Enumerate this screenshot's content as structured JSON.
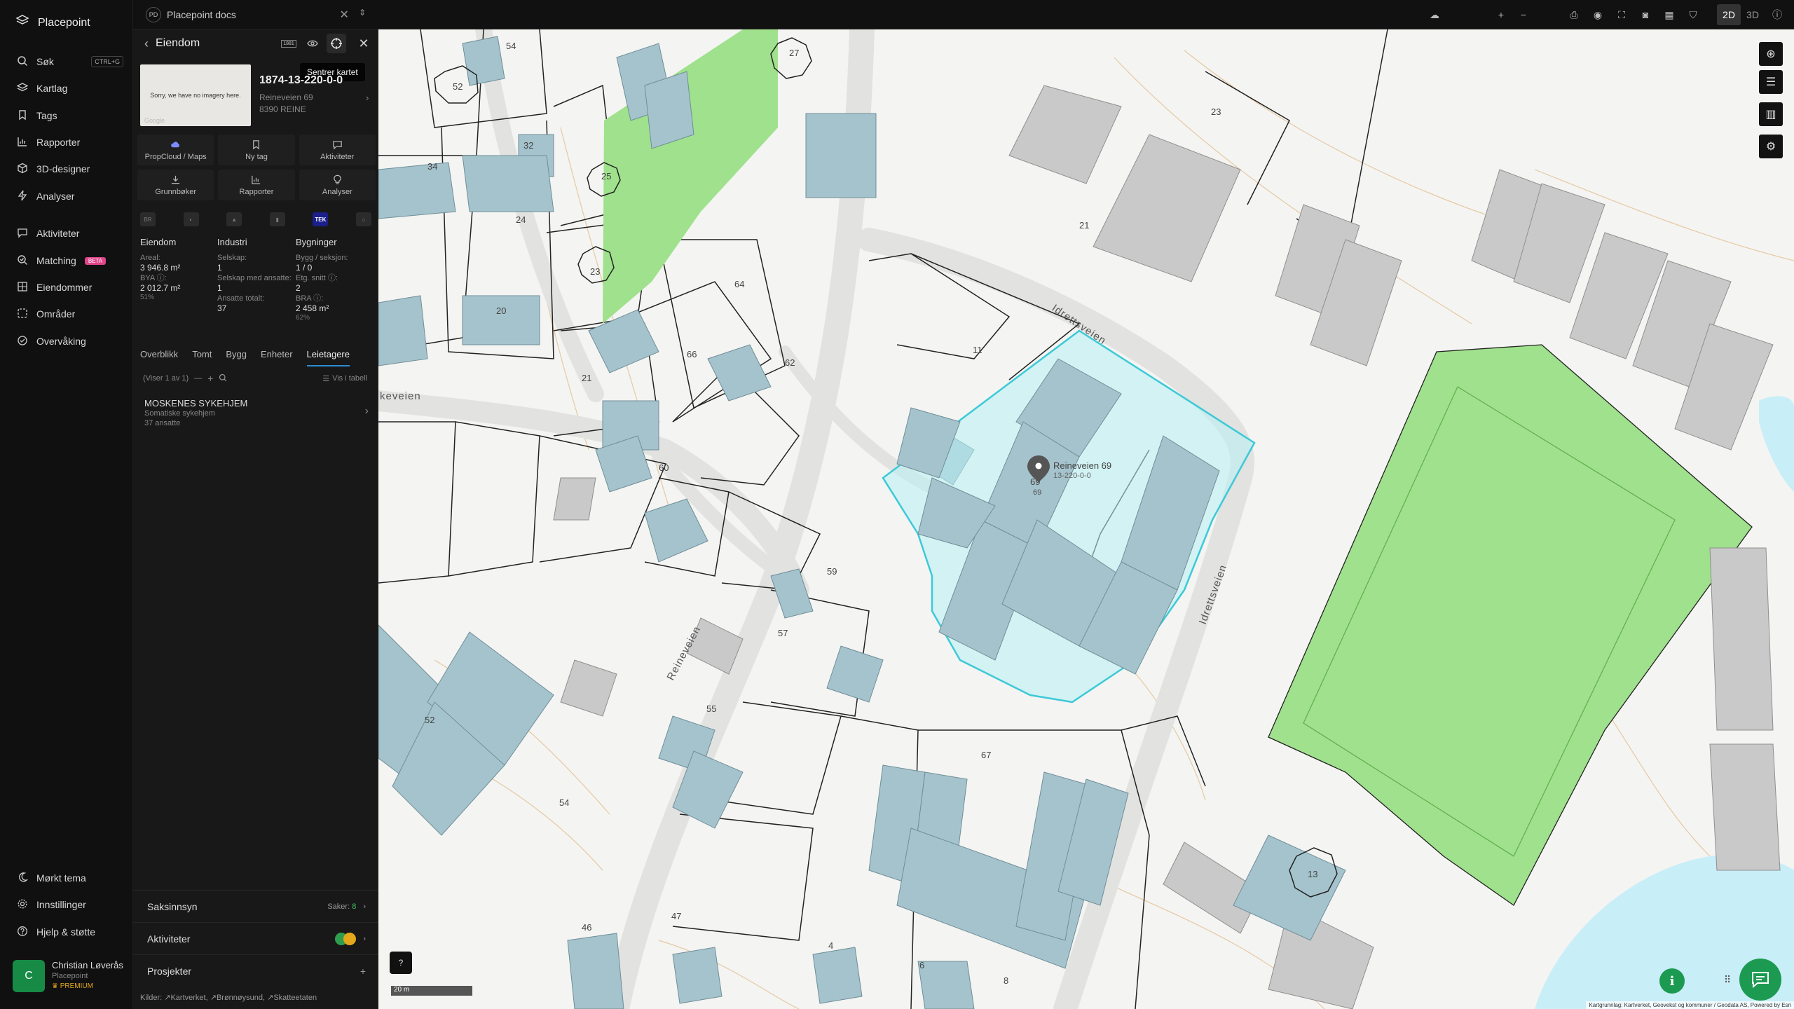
{
  "app": {
    "name": "Placepoint"
  },
  "sidebar": {
    "items": [
      {
        "label": "Søk",
        "shortcut": "CTRL+G"
      },
      {
        "label": "Kartlag"
      },
      {
        "label": "Tags"
      },
      {
        "label": "Rapporter"
      },
      {
        "label": "3D-designer"
      },
      {
        "label": "Analyser"
      },
      {
        "label": "Aktiviteter"
      },
      {
        "label": "Matching",
        "badge": "BETA"
      },
      {
        "label": "Eiendommer"
      },
      {
        "label": "Områder"
      },
      {
        "label": "Overvåking"
      }
    ],
    "bottom": [
      {
        "label": "Mørkt tema"
      },
      {
        "label": "Innstillinger"
      },
      {
        "label": "Hjelp & støtte"
      }
    ],
    "user": {
      "initial": "C",
      "name": "Christian Løverås",
      "org": "Placepoint",
      "plan": "PREMIUM"
    }
  },
  "panel": {
    "workspace": {
      "badge": "PD",
      "title": "Placepoint docs"
    },
    "header": {
      "title": "Eiendom",
      "badge_1881": "1881",
      "tooltip": "Sentrer kartet"
    },
    "property": {
      "thumbnail_text": "Sorry, we have no imagery here.",
      "thumbnail_brand": "Google",
      "id": "1874-13-220-0-0",
      "address": "Reineveien 69",
      "postal": "8390 REINE"
    },
    "actions": [
      {
        "label": "PropCloud / Maps",
        "icon": "propcloud-icon"
      },
      {
        "label": "Ny tag",
        "icon": "bookmark-icon"
      },
      {
        "label": "Aktiviteter",
        "icon": "chat-icon"
      },
      {
        "label": "Grunnbøker",
        "icon": "download-icon"
      },
      {
        "label": "Rapporter",
        "icon": "chart-icon"
      },
      {
        "label": "Analyser",
        "icon": "bulb-icon"
      }
    ],
    "sources": [
      {
        "label": "BR"
      },
      {
        "label": "◐"
      },
      {
        "label": "▲"
      },
      {
        "label": "▮"
      },
      {
        "label": "TEK"
      },
      {
        "label": "⌂"
      }
    ],
    "stats": {
      "eiendom": {
        "title": "Eiendom",
        "areal_label": "Areal:",
        "areal": "3 946.8 m²",
        "bya_label": "BYA ⓘ:",
        "bya": "2 012.7 m²",
        "bya_pct": "51%"
      },
      "industri": {
        "title": "Industri",
        "selskap_label": "Selskap:",
        "selskap": "1",
        "ansatte_label": "Selskap med ansatte:",
        "ansatte": "1",
        "total_label": "Ansatte totalt:",
        "total": "37"
      },
      "bygninger": {
        "title": "Bygninger",
        "bygg_label": "Bygg / seksjon:",
        "bygg": "1 / 0",
        "etg_label": "Etg. snitt ⓘ:",
        "etg": "2",
        "bra_label": "BRA ⓘ:",
        "bra": "2 458 m²",
        "bra_pct": "62%"
      }
    },
    "tabs": [
      {
        "label": "Overblikk"
      },
      {
        "label": "Tomt"
      },
      {
        "label": "Bygg"
      },
      {
        "label": "Enheter"
      },
      {
        "label": "Leietagere",
        "active": true
      }
    ],
    "list": {
      "count": "(Viser 1 av 1)",
      "table_label": "Vis i tabell"
    },
    "tenant": {
      "name": "MOSKENES SYKEHJEM",
      "type": "Somatiske sykehjem",
      "employees": "37 ansatte"
    },
    "sections": {
      "saksinnsyn": {
        "label": "Saksinnsyn",
        "count_label": "Saker:",
        "count": "8"
      },
      "aktiviteter": {
        "label": "Aktiviteter"
      },
      "prosjekter": {
        "label": "Prosjekter"
      }
    },
    "footer": {
      "label": "Kilder:",
      "s1": "Kartverket,",
      "s2": "Brønnøysund,",
      "s3": "Skatteetaten"
    }
  },
  "topbar": {
    "north": "N",
    "mode_2d": "2D",
    "mode_3d": "3D"
  },
  "map": {
    "roads": [
      {
        "label": "Idrettsveien"
      },
      {
        "label": "Idrettsveien"
      },
      {
        "label": "Reineveien"
      },
      {
        "label": "keveien"
      }
    ],
    "house_numbers": [
      "54",
      "27",
      "52",
      "32",
      "34",
      "25",
      "24",
      "23",
      "20",
      "64",
      "66",
      "62",
      "21",
      "60",
      "11",
      "21",
      "23",
      "59",
      "57",
      "55",
      "52",
      "54",
      "47",
      "46",
      "4",
      "6",
      "8",
      "67",
      "69",
      "13"
    ],
    "selected": {
      "number": "69",
      "label": "Reineveien 69",
      "sublabel": "13-220-0-0"
    },
    "scale": "20 m",
    "attribution": "Kartgrunnlag: Kartverket, Geovekst og kommuner / Geodata AS, Powered by Esri",
    "colors": {
      "building": "#a5c3cc",
      "park": "#9fe18c",
      "water": "#c8eef8",
      "selection": "#3cc9d8"
    }
  }
}
